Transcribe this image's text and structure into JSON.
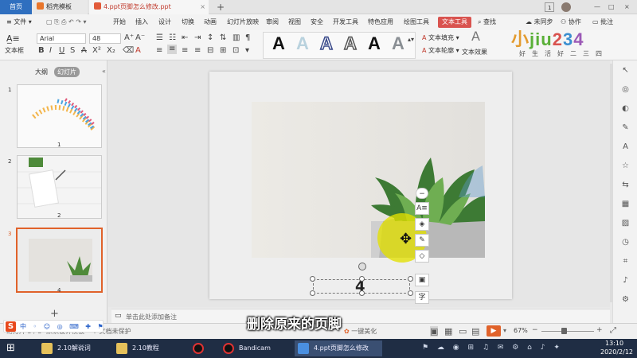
{
  "titlebar": {
    "tabs": [
      {
        "label": "首页"
      },
      {
        "label": "稻壳模板"
      },
      {
        "label": "4.ppt页脚怎么修改.ppt"
      }
    ],
    "badge": "1"
  },
  "menubar": {
    "file_label": "文件",
    "items": [
      "开始",
      "插入",
      "设计",
      "切换",
      "动画",
      "幻灯片放映",
      "审阅",
      "视图",
      "安全",
      "开发工具",
      "特色应用",
      "绘图工具",
      "文本工具"
    ],
    "search_label": "查找",
    "sync_label": "未同步",
    "collab_label": "协作",
    "comment_label": "批注"
  },
  "ribbon": {
    "textbox_label": "文本框",
    "font_name": "Arial",
    "font_size": "48",
    "text_fill_label": "文本填充",
    "text_outline_label": "文本轮廓",
    "text_effect_label": "文本效果",
    "style_glyphs": [
      "A",
      "A",
      "A",
      "A",
      "A",
      "A"
    ]
  },
  "logo": {
    "main": "小jiu234",
    "sub": "好生活好二三四"
  },
  "leftpanel": {
    "tab_outline": "大纲",
    "tab_slides": "幻灯片",
    "slides": [
      {
        "number": "1",
        "label": "1"
      },
      {
        "number": "2",
        "label": "2"
      },
      {
        "number": "3",
        "label": "4"
      }
    ],
    "add_label": "+"
  },
  "slide": {
    "footer_text": "4"
  },
  "notes": {
    "placeholder": "单击此处添加备注"
  },
  "status": {
    "slide_info": "幻灯片 3 / 3",
    "theme": "默认设计模板",
    "protect": "文档未保护",
    "beautify": "一键美化",
    "zoom": "67%"
  },
  "subtitle": "删除原来的页脚",
  "taskbar": {
    "items": [
      {
        "label": "2.10解说词"
      },
      {
        "label": "2.10教程"
      },
      {
        "label": ""
      },
      {
        "label": "Bandicam"
      },
      {
        "label": "4.ppt页脚怎么修改"
      }
    ],
    "time": "13:10",
    "date": "2020/2/12"
  },
  "colors": {
    "accent": "#d9534f",
    "title_active": "#2f6fbf",
    "taskbar": "#1f2d44",
    "highlight": "#e3e000"
  }
}
